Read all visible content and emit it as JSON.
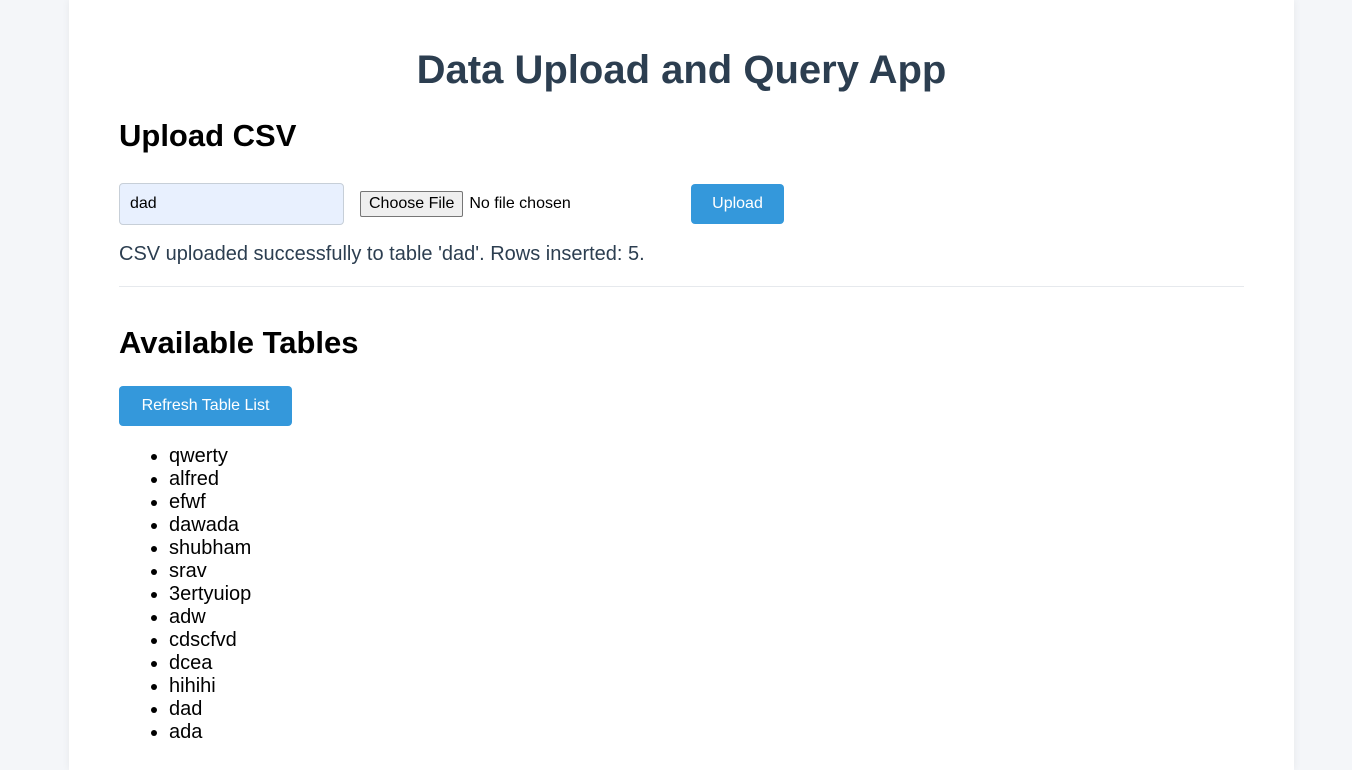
{
  "app": {
    "title": "Data Upload and Query App"
  },
  "upload": {
    "heading": "Upload CSV",
    "table_name_value": "dad",
    "choose_file_label": "Choose File",
    "file_status": "No file chosen",
    "upload_button_label": "Upload",
    "status_message": "CSV uploaded successfully to table 'dad'. Rows inserted: 5."
  },
  "tables": {
    "heading": "Available Tables",
    "refresh_button_label": "Refresh Table List",
    "items": [
      "qwerty",
      "alfred",
      "efwf",
      "dawada",
      "shubham",
      "srav",
      "3ertyuiop",
      "adw",
      "cdscfvd",
      "dcea",
      "hihihi",
      "dad",
      "ada"
    ]
  },
  "colors": {
    "accent": "#3498db",
    "title": "#2c3e50",
    "input_background": "#e8f0fe",
    "page_background": "#f4f6f9"
  }
}
